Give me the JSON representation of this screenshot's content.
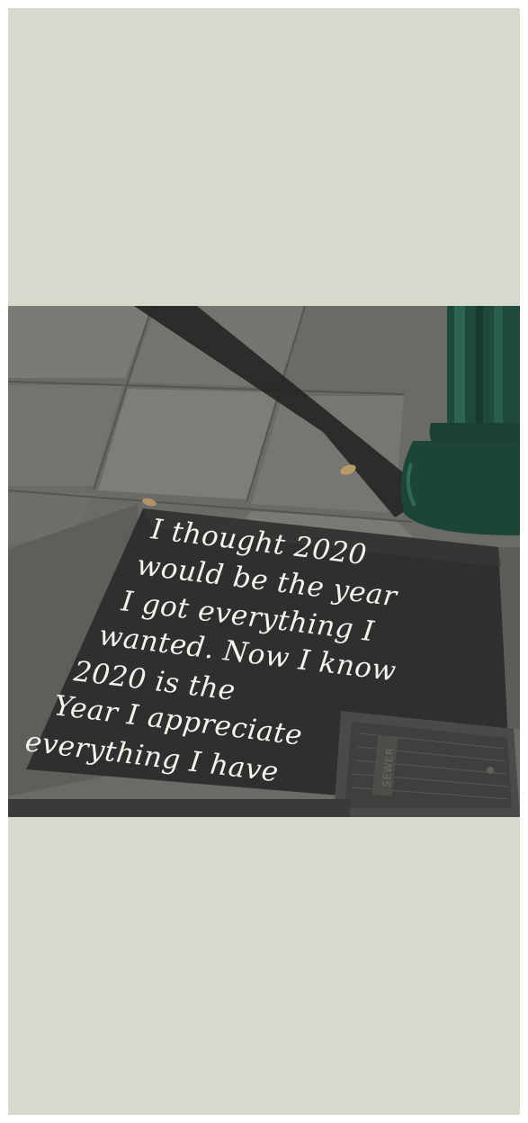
{
  "chalk_message": {
    "lines": [
      "I thought 2020",
      "would be the year",
      "I got everything I",
      "wanted. Now I know",
      "2020 is the",
      "Year I appreciate",
      "everything I have"
    ]
  },
  "grate": {
    "label": "SEWER"
  },
  "colors": {
    "background": "#d9d8cc",
    "pavement": "#6e6e6a",
    "chalkboard_slab": "#2f2f2f",
    "chalk": "#f4f3ec",
    "lamp_post": "#1f4a3b"
  }
}
